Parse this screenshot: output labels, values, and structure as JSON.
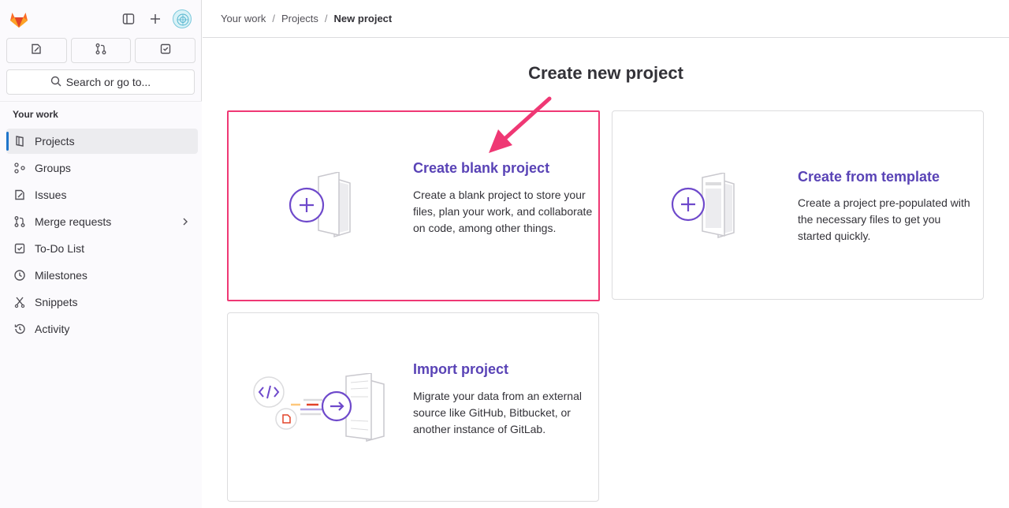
{
  "sidebar": {
    "search_label": "Search or go to...",
    "section_heading": "Your work",
    "items": [
      {
        "label": "Projects",
        "icon": "project-icon",
        "active": true
      },
      {
        "label": "Groups",
        "icon": "group-icon"
      },
      {
        "label": "Issues",
        "icon": "issues-icon"
      },
      {
        "label": "Merge requests",
        "icon": "merge-request-icon"
      },
      {
        "label": "To-Do List",
        "icon": "todo-icon"
      },
      {
        "label": "Milestones",
        "icon": "milestone-icon"
      },
      {
        "label": "Snippets",
        "icon": "snippet-icon"
      },
      {
        "label": "Activity",
        "icon": "history-icon"
      }
    ]
  },
  "breadcrumb": {
    "items": [
      "Your work",
      "Projects",
      "New project"
    ],
    "separator": "/"
  },
  "page": {
    "title": "Create new project"
  },
  "cards": [
    {
      "title": "Create blank project",
      "description": "Create a blank project to store your files, plan your work, and collaborate on code, among other things."
    },
    {
      "title": "Create from template",
      "description": "Create a project pre-populated with the necessary files to get you started quickly."
    },
    {
      "title": "Import project",
      "description": "Migrate your data from an external source like GitHub, Bitbucket, or another instance of GitLab."
    }
  ],
  "colors": {
    "accent": "#5943b6",
    "highlight": "#ef3874",
    "active_indicator": "#1f75cb",
    "brand_orange": "#e24329"
  }
}
